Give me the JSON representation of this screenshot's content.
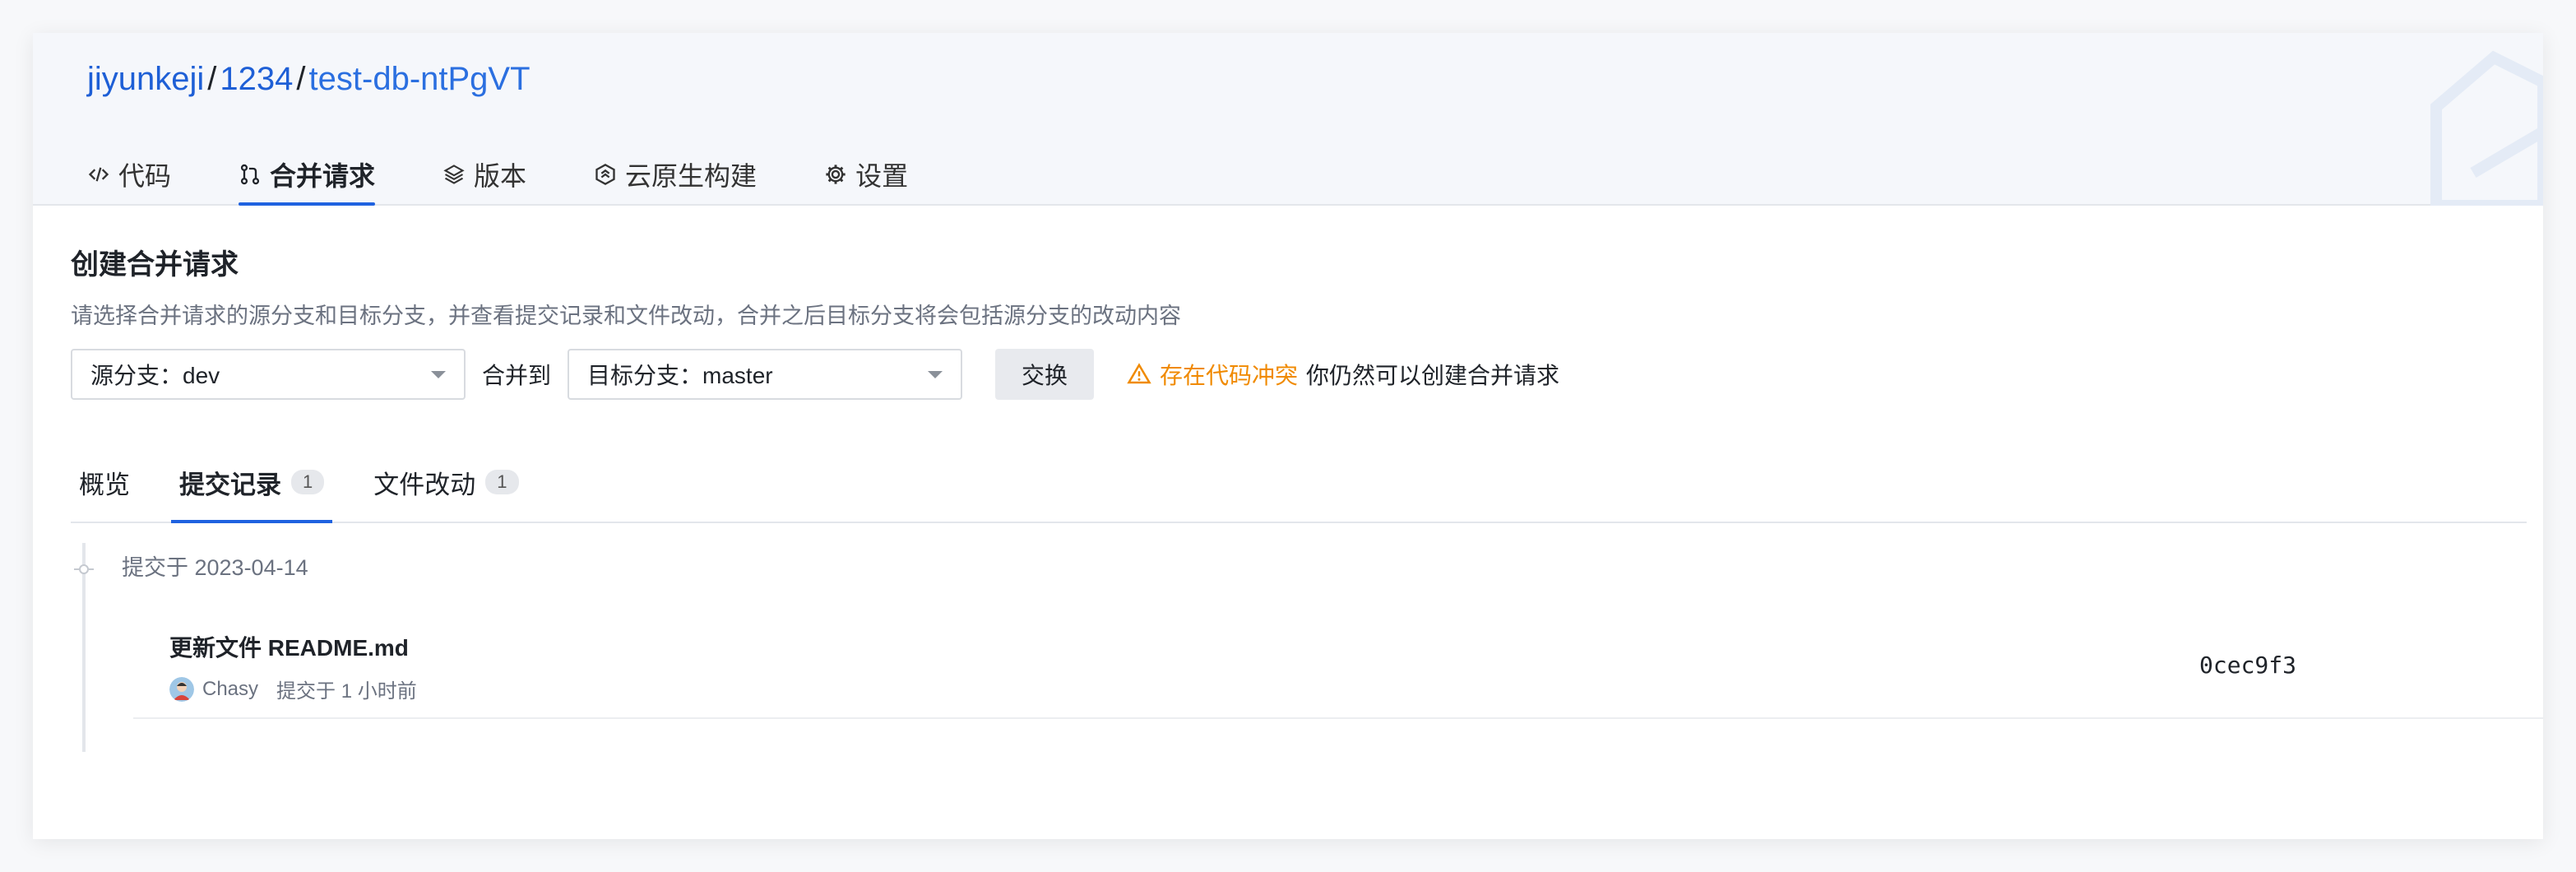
{
  "breadcrumb": {
    "org": "jiyunkeji",
    "sep1": "/",
    "group": "1234",
    "sep2": "/",
    "repo": "test-db-ntPgVT"
  },
  "nav": {
    "items": [
      {
        "label": "代码",
        "icon": "code-icon"
      },
      {
        "label": "合并请求",
        "icon": "merge-request-icon",
        "active": true
      },
      {
        "label": "版本",
        "icon": "layers-icon"
      },
      {
        "label": "云原生构建",
        "icon": "build-icon"
      },
      {
        "label": "设置",
        "icon": "gear-icon"
      }
    ]
  },
  "page": {
    "title": "创建合并请求",
    "description": "请选择合并请求的源分支和目标分支，并查看提交记录和文件改动，合并之后目标分支将会包括源分支的改动内容"
  },
  "controls": {
    "source_branch": "源分支：dev",
    "merge_to_label": "合并到",
    "target_branch": "目标分支：master",
    "swap_label": "交换",
    "conflict_text": "存在代码冲突",
    "conflict_note": "你仍然可以创建合并请求"
  },
  "tabs": [
    {
      "label": "概览"
    },
    {
      "label": "提交记录",
      "count": "1",
      "active": true
    },
    {
      "label": "文件改动",
      "count": "1"
    }
  ],
  "commits": {
    "date_header": "提交于 2023-04-14",
    "items": [
      {
        "title": "更新文件 README.md",
        "author": "Chasy",
        "time": "提交于 1 小时前",
        "sha": "0cec9f3"
      }
    ]
  },
  "colors": {
    "accent": "#1f62e0",
    "warning": "#f08a00",
    "breadcrumb": "#1e5fd6"
  }
}
